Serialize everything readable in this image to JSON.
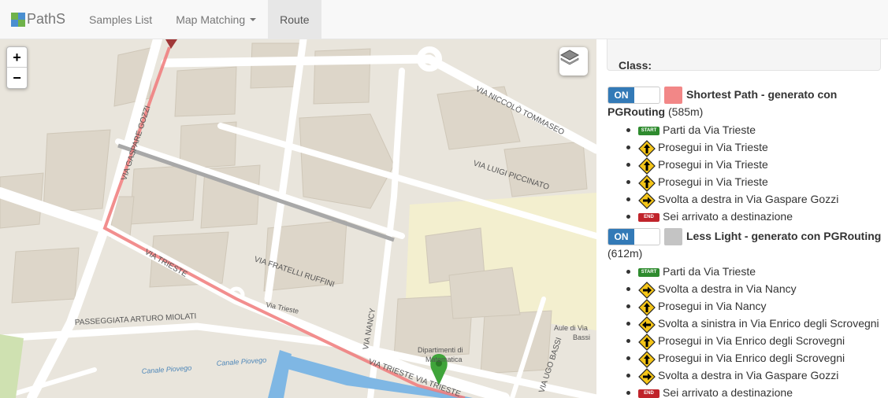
{
  "navbar": {
    "brand": "PathS",
    "items": [
      {
        "label": "Samples List"
      },
      {
        "label": "Map Matching"
      },
      {
        "label": "Route"
      }
    ]
  },
  "map": {
    "zoom_in": "+",
    "zoom_out": "−",
    "labels": {
      "via_gaspare_gozzi": "VIA GASPARE GOZZI",
      "via_niccolo_tommaseo": "VIA NICCOLÒ TOMMASEO",
      "via_luigi_piccinato": "VIA LUIGI PICCINATO",
      "via_fratelli_ruffini": "VIA FRATELLI RUFFINI",
      "via_trieste_upper": "VIA TRIESTE",
      "via_trieste_small": "Via Trieste",
      "passeggiata": "PASSEGGIATA ARTURO MIOLATI",
      "via_nancy": "VIA NANCY",
      "dipartimenti_1": "Dipartimenti di",
      "dipartimenti_2": "Matematica",
      "aule_1": "Aule di Via",
      "aule_2": "Bassi",
      "via_ugo_bassi": "VIA UGO BASSI",
      "canale": "Canale Piovego",
      "canale_2": "Canale Piovego",
      "via_trieste_bottom": "VIA TRIESTE VIA TRIESTE"
    },
    "colors": {
      "shortest_path": "#f07a7a",
      "less_light": "#9a9a9a",
      "marker": "#3fa43a",
      "water": "#7fb7e4",
      "park": "#f2efcd"
    }
  },
  "panel": {
    "class_label": "Class:",
    "routes": [
      {
        "toggle": "ON",
        "color": "#f28787",
        "title": "Shortest Path - generato con PGRouting",
        "distance": "(585m)",
        "steps": [
          {
            "icon": "start",
            "text": "Parti da Via Trieste"
          },
          {
            "icon": "straight",
            "text": "Prosegui in Via Trieste"
          },
          {
            "icon": "straight",
            "text": "Prosegui in Via Trieste"
          },
          {
            "icon": "straight",
            "text": "Prosegui in Via Trieste"
          },
          {
            "icon": "right",
            "text": "Svolta a destra in Via Gaspare Gozzi"
          },
          {
            "icon": "end",
            "text": "Sei arrivato a destinazione"
          }
        ]
      },
      {
        "toggle": "ON",
        "color": "#c4c4c4",
        "title": "Less Light - generato con PGRouting",
        "distance": "(612m)",
        "steps": [
          {
            "icon": "start",
            "text": "Parti da Via Trieste"
          },
          {
            "icon": "right",
            "text": "Svolta a destra in Via Nancy"
          },
          {
            "icon": "straight",
            "text": "Prosegui in Via Nancy"
          },
          {
            "icon": "left",
            "text": "Svolta a sinistra in Via Enrico degli Scrovegni"
          },
          {
            "icon": "straight",
            "text": "Prosegui in Via Enrico degli Scrovegni"
          },
          {
            "icon": "straight",
            "text": "Prosegui in Via Enrico degli Scrovegni"
          },
          {
            "icon": "right",
            "text": "Svolta a destra in Via Gaspare Gozzi"
          },
          {
            "icon": "end",
            "text": "Sei arrivato a destinazione"
          }
        ]
      }
    ],
    "badges": {
      "start": "START",
      "end": "END"
    }
  }
}
